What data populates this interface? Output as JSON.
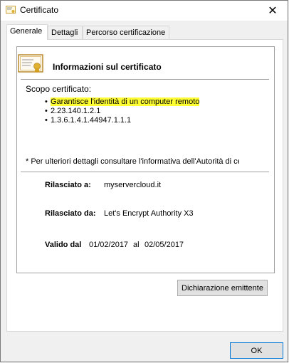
{
  "window": {
    "title": "Certificato",
    "title_icon": "certificate-icon",
    "close_icon": "close-icon"
  },
  "tabs": [
    {
      "label": "Generale",
      "active": true
    },
    {
      "label": "Dettagli",
      "active": false
    },
    {
      "label": "Percorso certificazione",
      "active": false
    }
  ],
  "general": {
    "heading": "Informazioni sul certificato",
    "scope_label": "Scopo certificato:",
    "purposes": [
      {
        "text": "Garantisce l'identità di un computer remoto",
        "highlighted": true
      },
      {
        "text": "2.23.140.1.2.1",
        "highlighted": false
      },
      {
        "text": "1.3.6.1.4.1.44947.1.1.1",
        "highlighted": false
      }
    ],
    "note": "* Per ulteriori dettagli consultare l'informativa dell'Autorità di ce",
    "issued_to_label": "Rilasciato a:",
    "issued_to_value": "myservercloud.it",
    "issued_by_label": "Rilasciato da:",
    "issued_by_value": "Let's Encrypt Authority X3",
    "valid_label": "Valido dal",
    "valid_from": "01/02/2017",
    "valid_sep": "al",
    "valid_to": "02/05/2017",
    "issuer_statement_button": "Dichiarazione emittente"
  },
  "footer": {
    "ok_button": "OK"
  },
  "colors": {
    "highlight": "#ffff33",
    "accent": "#0078d7"
  }
}
